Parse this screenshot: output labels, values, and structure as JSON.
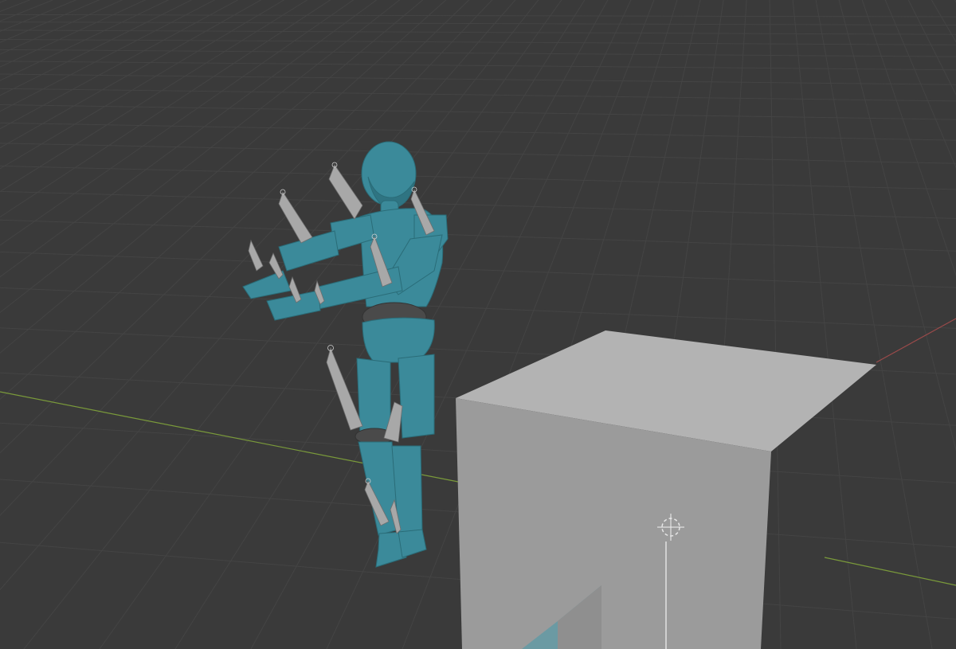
{
  "viewport": {
    "background_color": "#3a3a3a",
    "grid_color": "#444444",
    "x_axis_color": "#9a4a4a",
    "y_axis_color": "#7a9a3a",
    "mannequin_color": "#3b8a9a",
    "mannequin_shadow_color": "#2c6a78",
    "bone_color": "#9a9a9a",
    "cube_top_color": "#b5b5b5",
    "cube_front_color": "#9a9a9a",
    "cube_side_color": "#7a7a7a",
    "objects": [
      "mannequin",
      "armature",
      "cube",
      "3d-cursor"
    ]
  }
}
